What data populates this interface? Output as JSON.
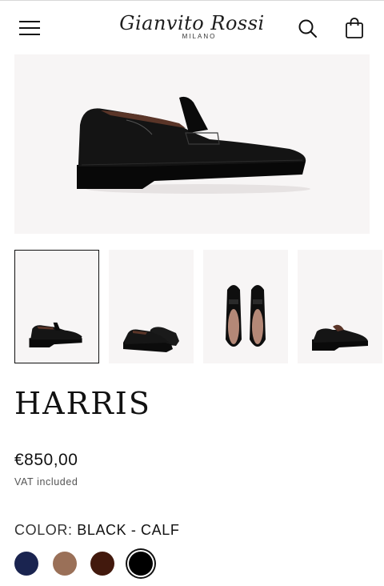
{
  "header": {
    "menu_icon": "hamburger-menu-icon",
    "logo_text": "Gianvito Rossi",
    "logo_sub": "MILANO",
    "search_icon": "search-icon",
    "bag_icon": "shopping-bag-icon"
  },
  "gallery": {
    "thumbnail_count": 4,
    "active_index": 0
  },
  "product": {
    "name": "HARRIS",
    "price": "€850,00",
    "vat_note": "VAT included",
    "color_label": "COLOR:",
    "color_value": "BLACK - CALF"
  },
  "swatches": [
    {
      "color": "#1a2450"
    },
    {
      "color": "#9a7058"
    },
    {
      "color": "#42190d"
    },
    {
      "color": "#000000",
      "selected": true
    }
  ]
}
